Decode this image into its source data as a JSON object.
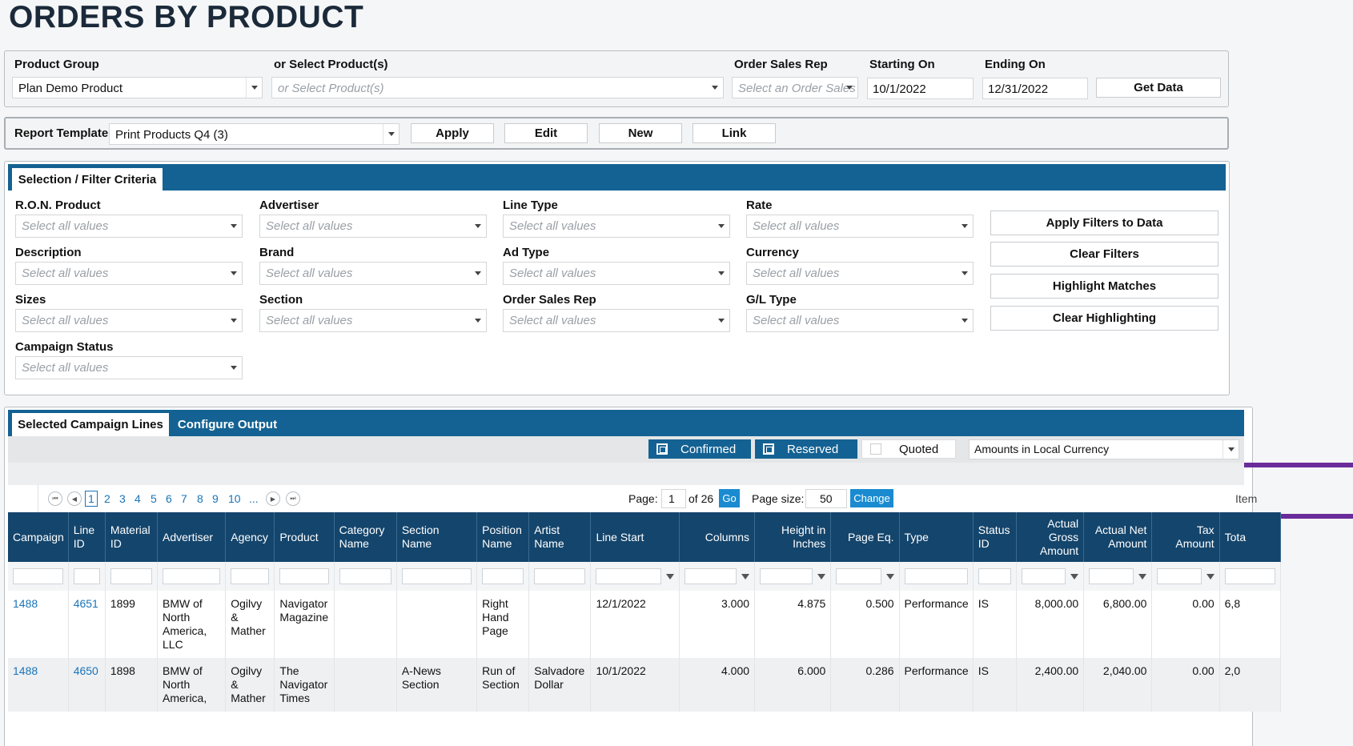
{
  "page": {
    "title": "ORDERS BY PRODUCT"
  },
  "top_filters": {
    "product_group_label": "Product Group",
    "product_group_value": "Plan Demo Product",
    "select_products_label": "or Select Product(s)",
    "select_products_placeholder": "or Select Product(s)",
    "order_sales_rep_label": "Order Sales Rep",
    "order_sales_rep_placeholder": "Select an Order Sales",
    "starting_on_label": "Starting On",
    "starting_on_value": "10/1/2022",
    "ending_on_label": "Ending On",
    "ending_on_value": "12/31/2022",
    "get_data_label": "Get Data"
  },
  "report_template": {
    "label": "Report Template",
    "value": "Print Products Q4 (3)",
    "apply_label": "Apply",
    "edit_label": "Edit",
    "new_label": "New",
    "link_label": "Link"
  },
  "selection": {
    "tab_label": "Selection / Filter Criteria",
    "placeholder": "Select all values",
    "fields": {
      "ron_product": "R.O.N. Product",
      "advertiser": "Advertiser",
      "line_type": "Line Type",
      "rate": "Rate",
      "description": "Description",
      "brand": "Brand",
      "ad_type": "Ad Type",
      "currency": "Currency",
      "sizes": "Sizes",
      "section": "Section",
      "order_sales_rep": "Order Sales Rep",
      "gl_type": "G/L Type",
      "campaign_status": "Campaign Status"
    },
    "buttons": {
      "apply_filters": "Apply Filters to Data",
      "clear_filters": "Clear Filters",
      "highlight_matches": "Highlight Matches",
      "clear_highlighting": "Clear Highlighting"
    }
  },
  "lines": {
    "tab_selected": "Selected Campaign Lines",
    "tab_configure": "Configure Output",
    "toggles": {
      "confirmed": "Confirmed",
      "reserved": "Reserved",
      "quoted": "Quoted"
    },
    "currency_select": "Amounts in Local Currency",
    "pager": {
      "pages": [
        "1",
        "2",
        "3",
        "4",
        "5",
        "6",
        "7",
        "8",
        "9",
        "10",
        "..."
      ],
      "page_label": "Page:",
      "page_value": "1",
      "of_label": "of 26",
      "go_label": "Go",
      "page_size_label": "Page size:",
      "page_size_value": "50",
      "change_label": "Change",
      "items_label": "Item"
    },
    "columns": [
      "Campaign",
      "Line ID",
      "Material ID",
      "Advertiser",
      "Agency",
      "Product",
      "Category Name",
      "Section Name",
      "Position Name",
      "Artist Name",
      "Line Start",
      "Columns",
      "Height in Inches",
      "Page Eq.",
      "Type",
      "Status ID",
      "Actual Gross Amount",
      "Actual Net Amount",
      "Tax Amount",
      "Tota"
    ],
    "rows": [
      {
        "campaign": "1488",
        "line_id": "4651",
        "material_id": "1899",
        "advertiser": "BMW of North America, LLC",
        "agency": "Ogilvy & Mather",
        "product": "Navigator Magazine",
        "category": "",
        "section": "",
        "position": "Right Hand Page",
        "artist": "",
        "line_start": "12/1/2022",
        "columns": "3.000",
        "height": "4.875",
        "page_eq": "0.500",
        "type": "Performance",
        "status": "IS",
        "gross": "8,000.00",
        "net": "6,800.00",
        "tax": "0.00",
        "total": "6,8"
      },
      {
        "campaign": "1488",
        "line_id": "4650",
        "material_id": "1898",
        "advertiser": "BMW of North America,",
        "agency": "Ogilvy & Mather",
        "product": "The Navigator Times",
        "category": "",
        "section": "A-News Section",
        "position": "Run of Section",
        "artist": "Salvadore Dollar",
        "line_start": "10/1/2022",
        "columns": "4.000",
        "height": "6.000",
        "page_eq": "0.286",
        "type": "Performance",
        "status": "IS",
        "gross": "2,400.00",
        "net": "2,040.00",
        "tax": "0.00",
        "total": "2,0"
      }
    ]
  },
  "colors": {
    "accent": "#146293",
    "header": "#14456c",
    "link": "#1a74b8",
    "highlight": "#6a2c9a"
  }
}
